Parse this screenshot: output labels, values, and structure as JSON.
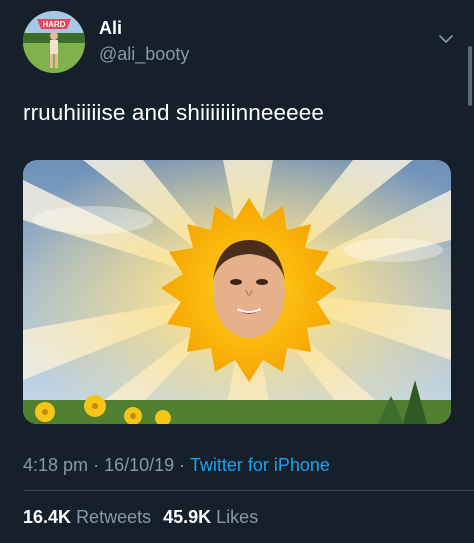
{
  "user": {
    "name": "Ali",
    "handle": "@ali_booty",
    "avatar_badge_text": "HARD"
  },
  "tweet": {
    "text": "rruuhiiiiise and shiiiiiiinneeeee"
  },
  "meta": {
    "time": "4:18 pm",
    "separator": "·",
    "date": "16/10/19",
    "source": "Twitter for iPhone"
  },
  "stats": {
    "retweets_count": "16.4K",
    "retweets_label": "Retweets",
    "likes_count": "45.9K",
    "likes_label": "Likes"
  },
  "icons": {
    "menu": "chevron-down-icon"
  },
  "colors": {
    "background": "#15202b",
    "secondary_text": "#8899a6",
    "link": "#1da1f2",
    "divider": "#38444d"
  }
}
